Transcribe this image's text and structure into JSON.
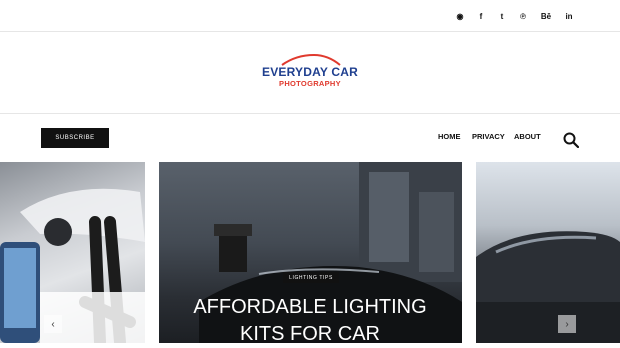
{
  "social": {
    "icons": [
      "globe-icon",
      "facebook-icon",
      "twitter-icon",
      "pinterest-icon",
      "behance-icon",
      "linkedin-icon"
    ],
    "glyphs": [
      "◉",
      "f",
      "t",
      "℗",
      "Bē",
      "in"
    ]
  },
  "logo": {
    "line1": "EVERYDAY CAR",
    "line2": "PHOTOGRAPHY",
    "primary_color": "#1f3f8f",
    "accent_color": "#e03a2e"
  },
  "nav": {
    "subscribe_label": "SUBSCRIBE",
    "items": [
      "HOME",
      "PRIVACY",
      "ABOUT"
    ],
    "search_icon": "search-icon"
  },
  "slider": {
    "featured": {
      "tag": "LIGHTING TIPS",
      "title_line1": "AFFORDABLE LIGHTING",
      "title_line2": "KITS FOR CAR"
    },
    "prev_label": "‹",
    "next_label": "›"
  }
}
